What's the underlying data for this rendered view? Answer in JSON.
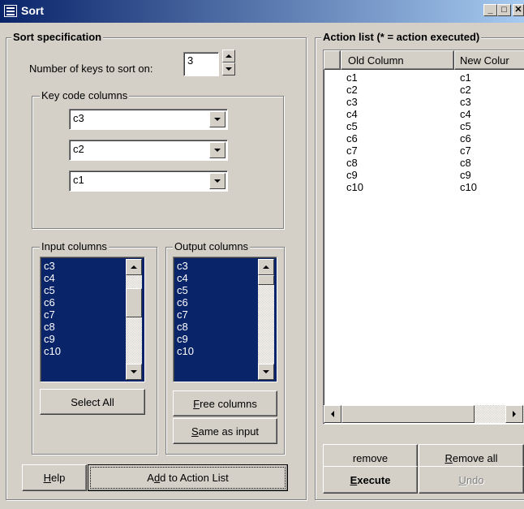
{
  "window": {
    "title": "Sort",
    "buttons": {
      "minimize": "_",
      "maximize": "□",
      "close": "✕"
    }
  },
  "sort_spec": {
    "title": "Sort  specification",
    "num_keys_label": "Number of keys to sort on:",
    "num_keys_value": "3",
    "key_columns_title": "Key code columns",
    "key_columns": [
      "c3",
      "c2",
      "c1"
    ],
    "input_columns_title": "Input columns",
    "output_columns_title": "Output columns",
    "input_columns": [
      "c3",
      "c4",
      "c5",
      "c6",
      "c7",
      "c8",
      "c9",
      "c10"
    ],
    "output_columns": [
      "c3",
      "c4",
      "c5",
      "c6",
      "c7",
      "c8",
      "c9",
      "c10"
    ],
    "select_all": "Select All",
    "free_columns_u": "F",
    "free_columns_rest": "ree columns",
    "same_as_input_u": "S",
    "same_as_input_rest": "ame as input",
    "help_u": "H",
    "help_rest": "elp",
    "add_pre": "A",
    "add_u": "d",
    "add_rest": "d to Action List"
  },
  "action_list": {
    "title": "Action list (* = action executed)",
    "columns": [
      "Old Column",
      "New Colur"
    ],
    "rows": [
      [
        "c1",
        "c1"
      ],
      [
        "c2",
        "c2"
      ],
      [
        "c3",
        "c3"
      ],
      [
        "c4",
        "c4"
      ],
      [
        "c5",
        "c5"
      ],
      [
        "c6",
        "c6"
      ],
      [
        "c7",
        "c7"
      ],
      [
        "c8",
        "c8"
      ],
      [
        "c9",
        "c9"
      ],
      [
        "c10",
        "c10"
      ]
    ],
    "remove": "remove",
    "remove_all_u": "R",
    "remove_all_rest": "emove all",
    "execute_u": "E",
    "execute_rest": "xecute",
    "undo_u": "U",
    "undo_rest": "ndo"
  },
  "colors": {
    "selection": "#0a246a",
    "face": "#d4d0c8"
  }
}
